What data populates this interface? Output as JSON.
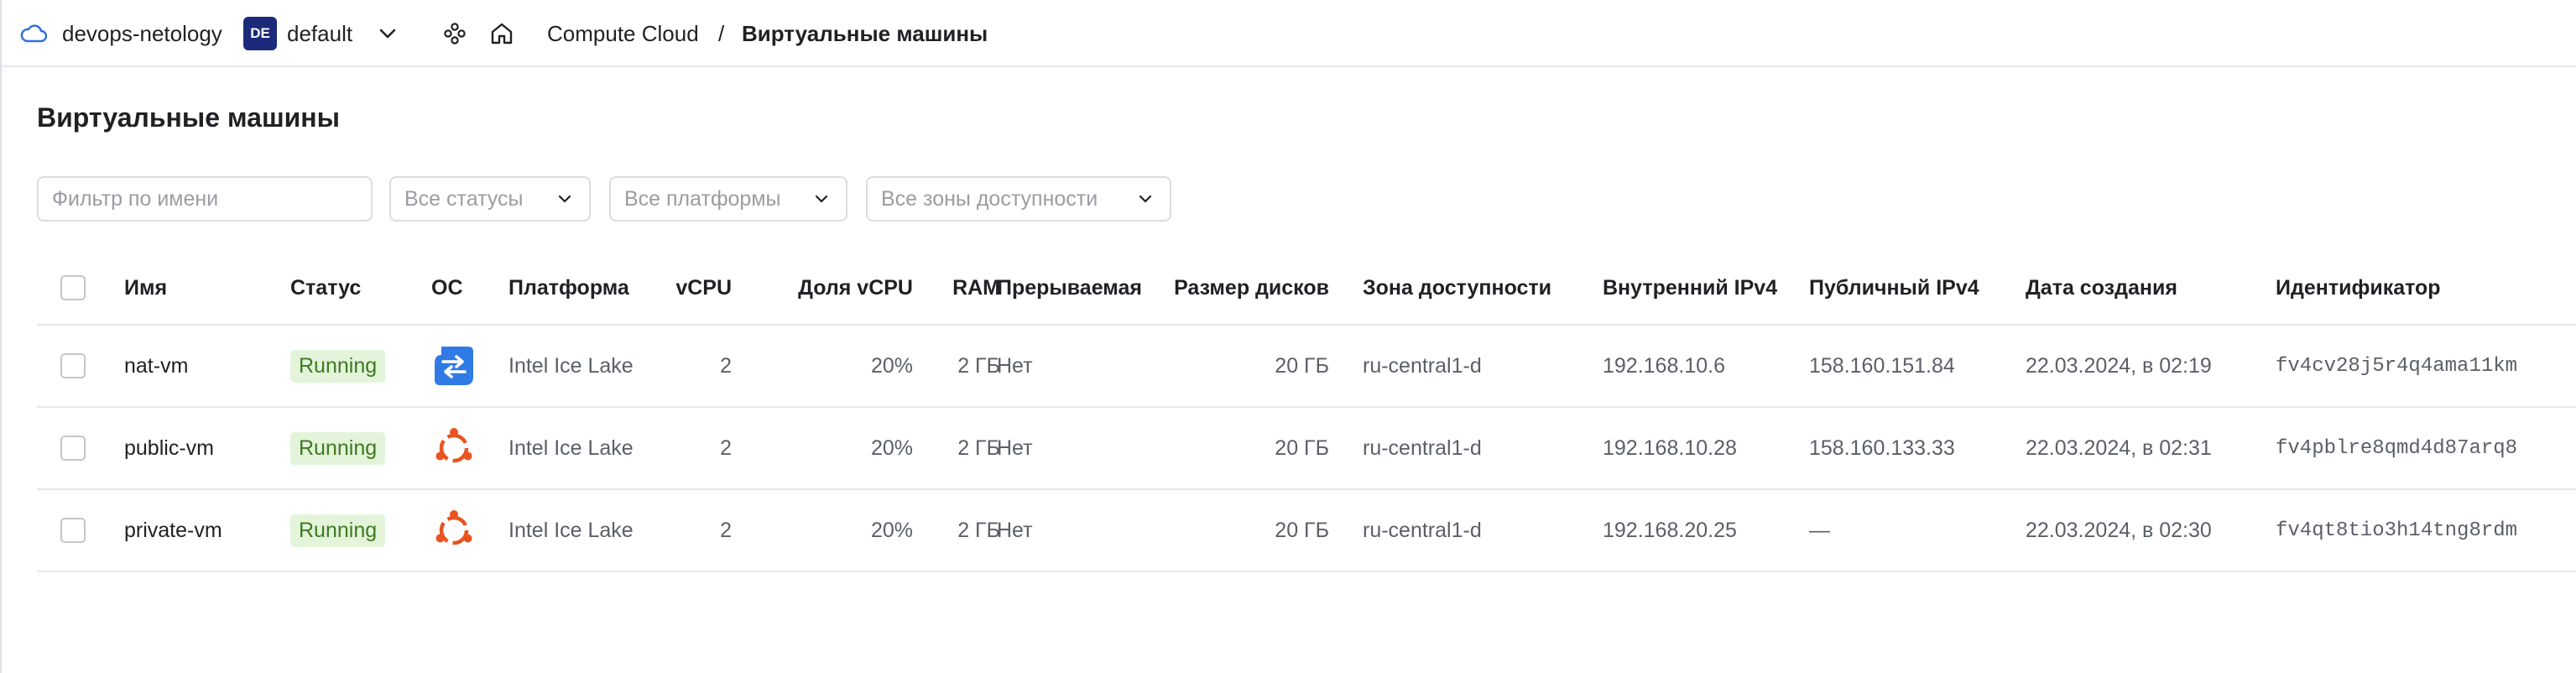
{
  "topbar": {
    "cloud_name": "devops-netology",
    "folder_badge": "DE",
    "folder_name": "default",
    "breadcrumb_service": "Compute Cloud",
    "breadcrumb_separator": "/",
    "breadcrumb_page": "Виртуальные машины"
  },
  "page": {
    "title": "Виртуальные машины"
  },
  "filters": {
    "name_placeholder": "Фильтр по имени",
    "status": "Все статусы",
    "platform": "Все платформы",
    "zone": "Все зоны доступности"
  },
  "table": {
    "columns": {
      "name": "Имя",
      "status": "Статус",
      "os": "ОС",
      "platform": "Платформа",
      "vcpu": "vCPU",
      "vcpu_share": "Доля vCPU",
      "ram": "RAM",
      "preemptible": "Прерываемая",
      "disk": "Размер дисков",
      "zone": "Зона доступности",
      "ip_internal": "Внутренний IPv4",
      "ip_public": "Публичный IPv4",
      "created": "Дата создания",
      "id": "Идентификатор"
    },
    "rows": [
      {
        "name": "nat-vm",
        "status": "Running",
        "os_icon": "nat-instance-icon",
        "platform": "Intel Ice Lake",
        "vcpu": "2",
        "vcpu_share": "20%",
        "ram": "2 ГБ",
        "preemptible": "Нет",
        "disk": "20 ГБ",
        "zone": "ru-central1-d",
        "ip_internal": "192.168.10.6",
        "ip_public": "158.160.151.84",
        "created": "22.03.2024, в 02:19",
        "id": "fv4cv28j5r4q4ama11km"
      },
      {
        "name": "public-vm",
        "status": "Running",
        "os_icon": "ubuntu-icon",
        "platform": "Intel Ice Lake",
        "vcpu": "2",
        "vcpu_share": "20%",
        "ram": "2 ГБ",
        "preemptible": "Нет",
        "disk": "20 ГБ",
        "zone": "ru-central1-d",
        "ip_internal": "192.168.10.28",
        "ip_public": "158.160.133.33",
        "created": "22.03.2024, в 02:31",
        "id": "fv4pblre8qmd4d87arq8"
      },
      {
        "name": "private-vm",
        "status": "Running",
        "os_icon": "ubuntu-icon",
        "platform": "Intel Ice Lake",
        "vcpu": "2",
        "vcpu_share": "20%",
        "ram": "2 ГБ",
        "preemptible": "Нет",
        "disk": "20 ГБ",
        "zone": "ru-central1-d",
        "ip_internal": "192.168.20.25",
        "ip_public": "—",
        "created": "22.03.2024, в 02:30",
        "id": "fv4qt8tio3h14tng8rdm"
      }
    ]
  },
  "colors": {
    "status_running_bg": "#e3f4da",
    "status_running_text": "#3d7a1f",
    "folder_badge_bg": "#1b2a7a",
    "ubuntu_orange": "#e95420",
    "nat_blue": "#2f7ae5"
  }
}
